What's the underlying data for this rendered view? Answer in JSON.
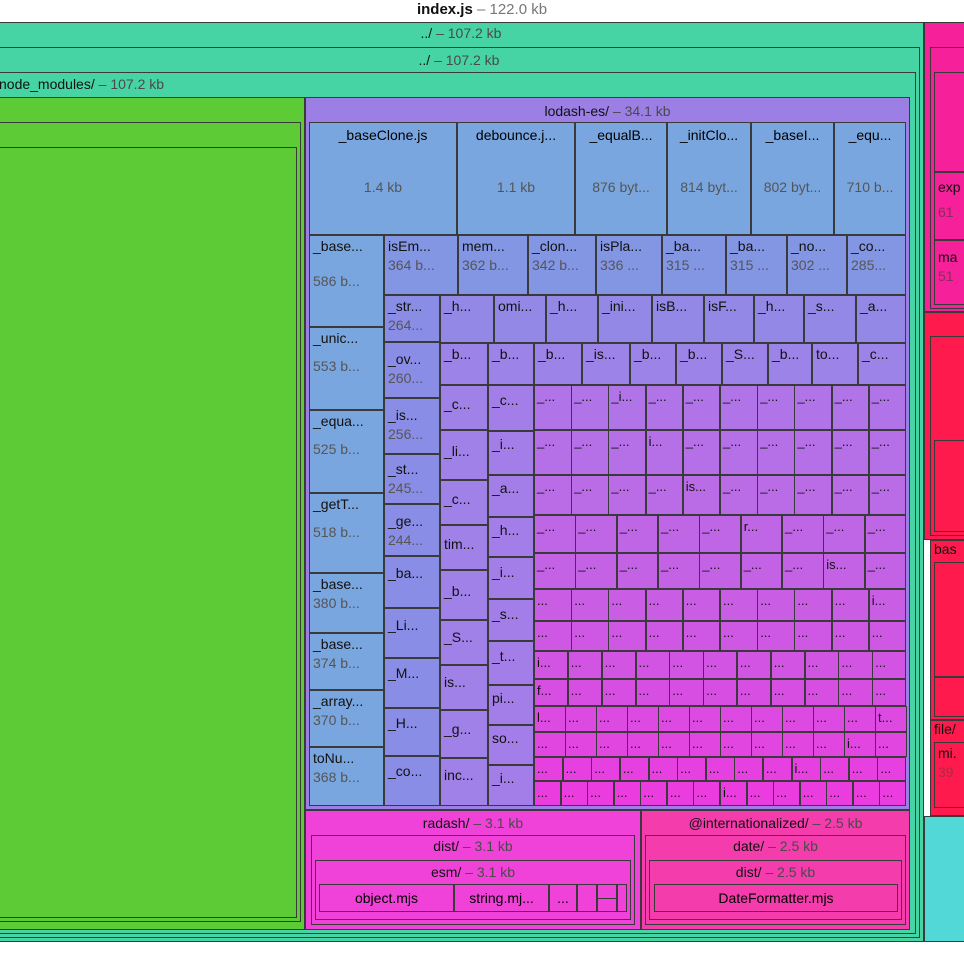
{
  "title": {
    "file": "index.js",
    "size": "– 122.0 kb"
  },
  "groups": {
    "root1": {
      "name": "../",
      "size": "– 107.2 kb"
    },
    "root2": {
      "name": "../",
      "size": "– 107.2 kb"
    },
    "node_modules": {
      "name": "node_modules/",
      "size": "– 107.2 kb"
    },
    "lodash": {
      "name": "lodash-es/",
      "size": "– 34.1 kb"
    },
    "radash": {
      "name": "radash/",
      "size": "– 3.1 kb"
    },
    "radash_dist": {
      "name": "dist/",
      "size": "– 3.1 kb"
    },
    "radash_esm": {
      "name": "esm/",
      "size": "– 3.1 kb"
    },
    "intl": {
      "name": "@internationalized/",
      "size": "– 2.5 kb"
    },
    "intl_date": {
      "name": "date/",
      "size": "– 2.5 kb"
    },
    "intl_dist": {
      "name": "dist/",
      "size": "– 2.5 kb"
    }
  },
  "lodash_top": [
    {
      "name": "_baseClone.js",
      "size": "1.4 kb"
    },
    {
      "name": "debounce.j...",
      "size": "1.1 kb"
    },
    {
      "name": "_equalB...",
      "size": "876 byt..."
    },
    {
      "name": "_initClo...",
      "size": "814 byt..."
    },
    {
      "name": "_baseI...",
      "size": "802 byt..."
    },
    {
      "name": "_equ...",
      "size": "710 b..."
    }
  ],
  "lodash_left": [
    {
      "name": "_base...",
      "size": "586 b..."
    },
    {
      "name": "_unic...",
      "size": "553 b..."
    },
    {
      "name": "_equa...",
      "size": "525 b..."
    },
    {
      "name": "_getT...",
      "size": "518 b..."
    },
    {
      "name": "_base...",
      "size": "380 b..."
    },
    {
      "name": "_base...",
      "size": "374 b..."
    },
    {
      "name": "_array...",
      "size": "370 b..."
    },
    {
      "name": "toNu...",
      "size": "368 b..."
    }
  ],
  "lodash_row2": [
    {
      "name": "isEm...",
      "size": "364 b..."
    },
    {
      "name": "mem...",
      "size": "362 b..."
    },
    {
      "name": "_clon...",
      "size": "342 b..."
    },
    {
      "name": "isPla...",
      "size": "336 ..."
    },
    {
      "name": "_ba...",
      "size": "315 ..."
    },
    {
      "name": "_ba...",
      "size": "315 ..."
    },
    {
      "name": "_no...",
      "size": "302 ..."
    },
    {
      "name": "_co...",
      "size": "285..."
    }
  ],
  "lodash_col2": [
    {
      "name": "_str...",
      "size": "264..."
    },
    {
      "name": "_ov...",
      "size": "260..."
    },
    {
      "name": "_is...",
      "size": "256..."
    },
    {
      "name": "_st...",
      "size": "245..."
    },
    {
      "name": "_ge...",
      "size": "244..."
    },
    {
      "name": "_ba..."
    },
    {
      "name": "_Li..."
    },
    {
      "name": "_M..."
    },
    {
      "name": "_H..."
    },
    {
      "name": "_co..."
    }
  ],
  "lodash_row3": [
    "_h...",
    "omi...",
    "_h...",
    "_ini...",
    "isB...",
    "isF...",
    "_h...",
    "_s...",
    "_a..."
  ],
  "lodash_row4": [
    "_b...",
    "_b...",
    "_b...",
    "_is...",
    "_b...",
    "_b...",
    "_S...",
    "_b...",
    "to...",
    "_c..."
  ],
  "lodash_col3": [
    "_c...",
    "_li...",
    "_c...",
    "tim...",
    "_b...",
    "_S...",
    "is...",
    "_g...",
    "inc..."
  ],
  "lodash_col4": [
    "_c...",
    "_i...",
    "_a...",
    "_h...",
    "_i...",
    "_s...",
    "_t...",
    "pi...",
    "so...",
    "_i..."
  ],
  "lodash_misc": [
    "_i...",
    "i...",
    "is...",
    "r...",
    "is...",
    "i...",
    "i...",
    "f...",
    "l...",
    "t...",
    "i...",
    "i...",
    "i...",
    "i..."
  ],
  "radash_files": [
    {
      "name": "object.mjs"
    },
    {
      "name": "string.mj..."
    },
    {
      "name": "..."
    }
  ],
  "intl_files": [
    {
      "name": "DateFormatter.mjs"
    }
  ],
  "right": {
    "exp_name": "exp",
    "exp_size": "61",
    "ma_name": "ma",
    "ma_size": "51",
    "bas_name": "bas",
    "file_name": "file/",
    "mi_name": "mi.",
    "mi_size": "39"
  },
  "colors": {
    "outer": "#47d4a4",
    "green_main": "#5dcb35",
    "lodash_bg": "#9b7fe4",
    "lodash_blue": "#7aa6e0",
    "lodash_violet": "#8b84e6",
    "lodash_purple": "#b173e8",
    "lodash_magenta": "#d95fe8",
    "radash": "#f042d8",
    "intl": "#f43cac",
    "right_pink": "#f5209a",
    "right_red": "#ff1a4d",
    "cyan": "#53d8d8"
  }
}
